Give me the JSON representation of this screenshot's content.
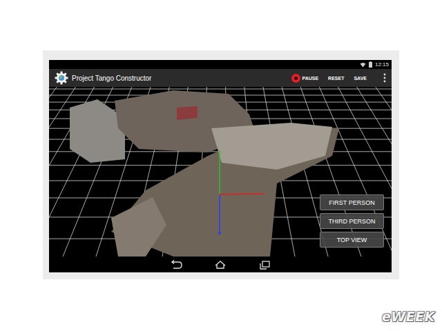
{
  "window": {
    "title": "Project Tango Constructor"
  },
  "status_bar": {
    "time": "12:15"
  },
  "actions": [
    {
      "label": "PAUSE",
      "kind": "record",
      "recording": true
    },
    {
      "label": "RESET",
      "kind": "text"
    },
    {
      "label": "SAVE",
      "kind": "text"
    }
  ],
  "view_buttons": [
    {
      "label": "FIRST PERSON",
      "selected": false
    },
    {
      "label": "THIRD PERSON",
      "selected": false
    },
    {
      "label": "TOP VIEW",
      "selected": false
    }
  ],
  "watermark": "eWEEK"
}
